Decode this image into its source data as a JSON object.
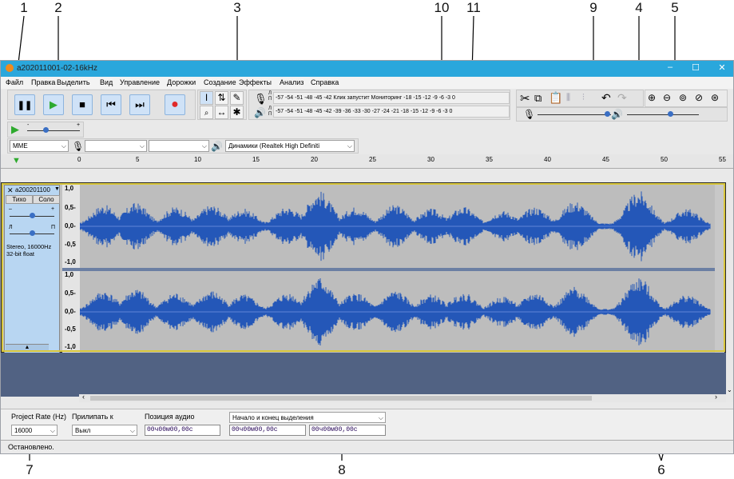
{
  "callouts": [
    "1",
    "2",
    "3",
    "10",
    "11",
    "9",
    "4",
    "5",
    "7",
    "8",
    "6"
  ],
  "window": {
    "title": "a202011001-02-16kHz",
    "controls": [
      "–",
      "☐",
      "✕"
    ]
  },
  "menu": [
    "Файл",
    "Правка",
    "Выделить",
    "Вид",
    "Управление",
    "Дорожки",
    "Создание",
    "Эффекты",
    "Анализ",
    "Справка"
  ],
  "transport": {
    "pause": "pause-icon",
    "play": "play-icon",
    "stop": "stop-icon",
    "skip_start": "skip-start-icon",
    "skip_end": "skip-end-icon",
    "record": "record-icon"
  },
  "tools": {
    "selection": "I",
    "envelope": "⇅",
    "draw": "✎",
    "zoom": "🔍",
    "timeshift": "↔",
    "multi": "✱"
  },
  "meters": {
    "record_letters": [
      "Л",
      "П"
    ],
    "record_scale": "-57 -54 -51 -48 -45 -42 Клик запустит Мониторинг -18 -15 -12 -9 -6 -3 0",
    "play_letters": [
      "Л",
      "П"
    ],
    "play_scale": "-57 -54 -51 -48 -45 -42 -39 -36 -33 -30 -27 -24 -21 -18 -15 -12 -9 -6 -3 0"
  },
  "play_at_speed": {
    "min": "-",
    "max": "+",
    "value": 0.35
  },
  "mixer": {
    "record_volume": 0.95,
    "play_volume": 0.6
  },
  "device": {
    "host": "MME",
    "recording": "",
    "channels": "",
    "playback": "Динамики (Realtek High Definiti"
  },
  "ruler": {
    "ticks": [
      "0",
      "5",
      "10",
      "15",
      "20",
      "25",
      "30",
      "35",
      "40",
      "45",
      "50",
      "55"
    ]
  },
  "track": {
    "name": "a200201100",
    "mute": "Тихо",
    "solo": "Соло",
    "gain_min": "–",
    "gain_max": "+",
    "pan_left": "Л",
    "pan_right": "П",
    "info_line1": "Stereo, 16000Hz",
    "info_line2": "32-bit float",
    "scale": [
      "1,0",
      "0,5-",
      "0,0-",
      "-0,5",
      "-1,0"
    ]
  },
  "selection_toolbar": {
    "rate_label": "Project Rate (Hz)",
    "rate_value": "16000",
    "snap_label": "Прилипать к",
    "snap_value": "Выкл",
    "pos_label": "Позиция аудио",
    "pos_value": "00ч00м00,00с",
    "range_label": "Начало и конец выделения",
    "start_value": "00ч00м00,00с",
    "end_value": "00ч00м00,00с"
  },
  "status": "Остановлено.",
  "colors": {
    "titlebar": "#2aa7dc",
    "waveform": "#2457b8",
    "track_panel": "#b8d6f2",
    "selection_border": "#d8c63a",
    "empty_area": "#516283",
    "record": "#e02a2a",
    "play": "#2eaa2e"
  }
}
